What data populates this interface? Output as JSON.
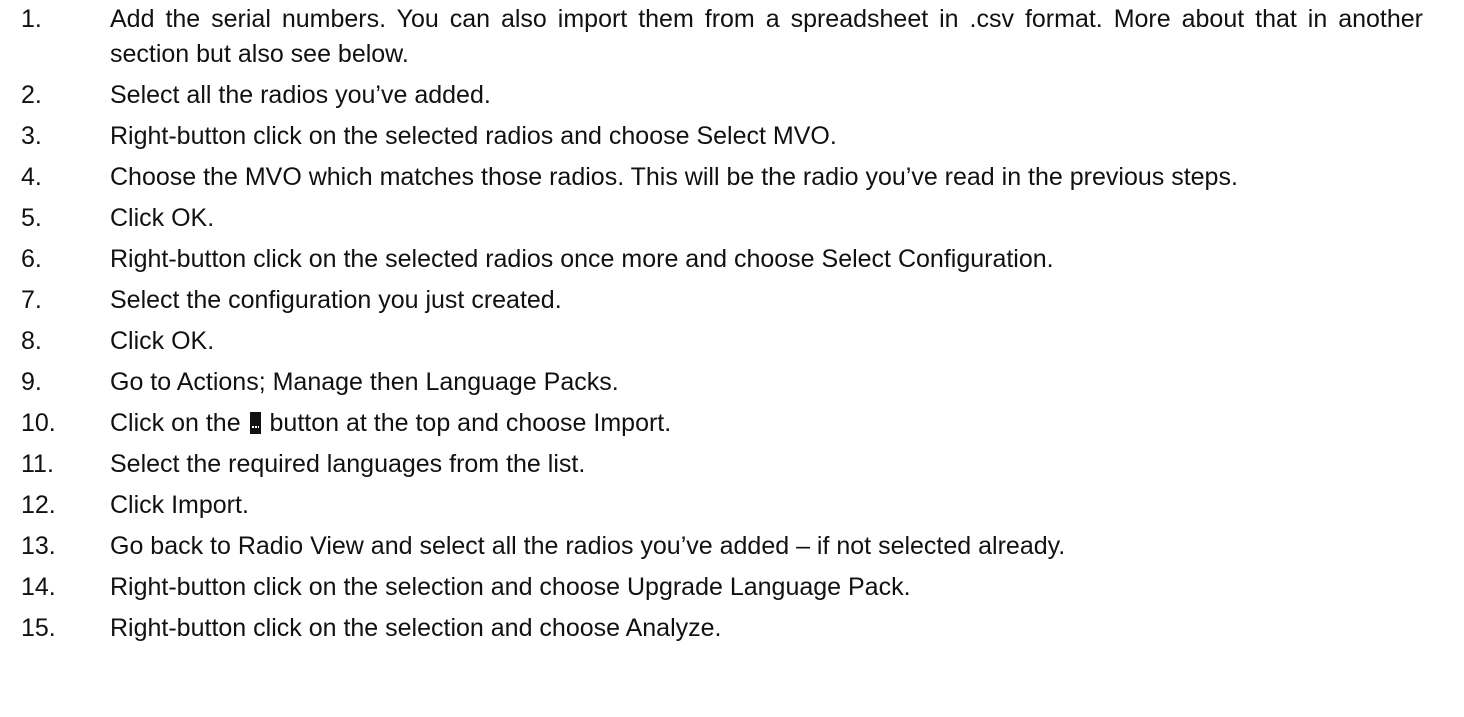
{
  "steps": [
    {
      "num": "1.",
      "text": "Add the serial numbers. You can also import them from a spreadsheet in .csv format. More about that in another section but also see below."
    },
    {
      "num": "2.",
      "text": "Select all the radios you’ve added."
    },
    {
      "num": "3.",
      "text": "Right-button click on the selected radios and choose Select MVO."
    },
    {
      "num": "4.",
      "text": "Choose the MVO which matches those radios. This will be the radio you’ve read in the previous steps."
    },
    {
      "num": "5.",
      "text": "Click OK."
    },
    {
      "num": "6.",
      "text": "Right-button click on the selected radios once more and choose Select Configuration."
    },
    {
      "num": "7.",
      "text": "Select the configuration you just created."
    },
    {
      "num": "8.",
      "text": "Click OK."
    },
    {
      "num": "9.",
      "text": "Go to Actions; Manage then Language Packs."
    },
    {
      "num": "10.",
      "text_before": "Click on the",
      "text_after": "button at the top and choose Import.",
      "icon": "ellipsis-button-icon"
    },
    {
      "num": "11.",
      "text": "Select the required languages from the list."
    },
    {
      "num": "12.",
      "text": "Click Import."
    },
    {
      "num": "13.",
      "text": "Go back to Radio View and select all the radios you’ve added – if not selected already."
    },
    {
      "num": "14.",
      "text": "Right-button click on the selection and choose Upgrade Language Pack."
    },
    {
      "num": "15.",
      "text": "Right-button click on the selection and choose Analyze."
    }
  ]
}
